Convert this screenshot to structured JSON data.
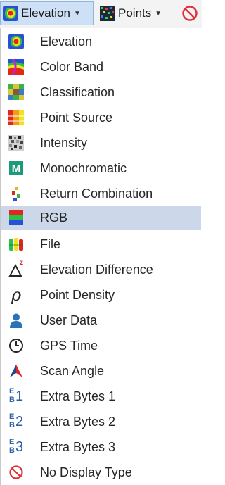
{
  "toolbar": {
    "elevation_label": "Elevation",
    "points_label": "Points"
  },
  "menu": {
    "items": [
      {
        "label": "Elevation",
        "icon": "elevation-icon"
      },
      {
        "label": "Color Band",
        "icon": "color-band-icon"
      },
      {
        "label": "Classification",
        "icon": "classification-icon"
      },
      {
        "label": "Point Source",
        "icon": "point-source-icon"
      },
      {
        "label": "Intensity",
        "icon": "intensity-icon"
      },
      {
        "label": "Monochromatic",
        "icon": "monochromatic-icon"
      },
      {
        "label": "Return Combination",
        "icon": "return-combination-icon"
      },
      {
        "label": "RGB",
        "icon": "rgb-icon"
      },
      {
        "label": "File",
        "icon": "file-icon"
      },
      {
        "label": "Elevation Difference",
        "icon": "elevation-difference-icon"
      },
      {
        "label": "Point Density",
        "icon": "point-density-icon"
      },
      {
        "label": "User Data",
        "icon": "user-data-icon"
      },
      {
        "label": "GPS Time",
        "icon": "gps-time-icon"
      },
      {
        "label": "Scan Angle",
        "icon": "scan-angle-icon"
      },
      {
        "label": "Extra Bytes 1",
        "icon": "extra-bytes-1-icon"
      },
      {
        "label": "Extra Bytes 2",
        "icon": "extra-bytes-2-icon"
      },
      {
        "label": "Extra Bytes 3",
        "icon": "extra-bytes-3-icon"
      },
      {
        "label": "No Display Type",
        "icon": "no-display-type-icon"
      }
    ],
    "selected_label": "RGB",
    "m_glyph": "M",
    "delta_superscript": "z",
    "rho_glyph": "ρ",
    "extra_e": "E",
    "extra_b": "B",
    "digit_1": "1",
    "digit_2": "2",
    "digit_3": "3"
  },
  "colors": {
    "selected_bg": "#ccd8ea",
    "pressed_button_bg": "#cde0f5",
    "no_display_red": "#e0303a",
    "accent_blue": "#2c5fa8"
  }
}
